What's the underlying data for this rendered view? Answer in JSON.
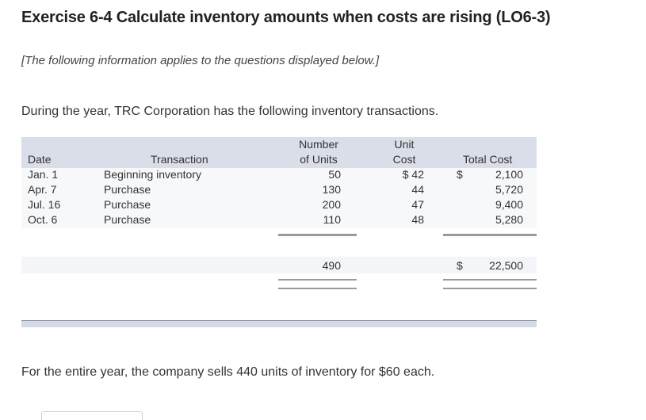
{
  "title": "Exercise 6-4 Calculate inventory amounts when costs are rising (LO6-3)",
  "note": "[The following information applies to the questions displayed below.]",
  "intro": "During  the year, TRC Corporation has the following inventory transactions.",
  "table": {
    "headers": {
      "date": "Date",
      "transaction": "Transaction",
      "units_line1": "Number",
      "units_line2": "of Units",
      "cost_line1": "Unit",
      "cost_line2": "Cost",
      "total": "Total Cost"
    },
    "rows": [
      {
        "date": "Jan. 1",
        "transaction": "Beginning inventory",
        "units": "50",
        "unit_cost": "$ 42",
        "total_prefix": "$",
        "total": "2,100"
      },
      {
        "date": "Apr. 7",
        "transaction": "Purchase",
        "units": "130",
        "unit_cost": "44",
        "total_prefix": "",
        "total": "5,720"
      },
      {
        "date": "Jul. 16",
        "transaction": "Purchase",
        "units": "200",
        "unit_cost": "47",
        "total_prefix": "",
        "total": "9,400"
      },
      {
        "date": "Oct. 6",
        "transaction": "Purchase",
        "units": "110",
        "unit_cost": "48",
        "total_prefix": "",
        "total": "5,280"
      }
    ],
    "totals": {
      "units": "490",
      "total_prefix": "$",
      "total": "22,500"
    }
  },
  "footer": "For the entire year, the company sells 440 units of inventory for $60 each."
}
